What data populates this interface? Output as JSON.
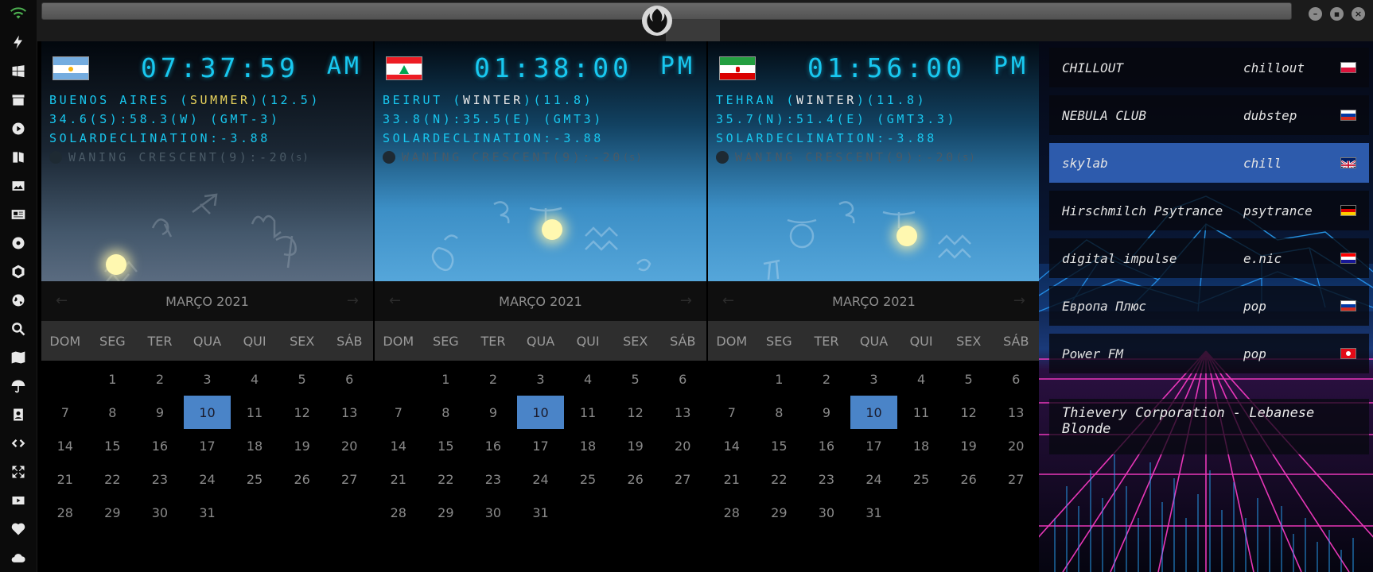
{
  "sidebar": {
    "icons": [
      "wifi-icon",
      "lightning-icon",
      "windows-icon",
      "archive-icon",
      "play-circle-icon",
      "map-book-icon",
      "image-icon",
      "news-icon",
      "rebel-icon",
      "hexagon-icon",
      "globe-icon",
      "search-icon",
      "map-icon",
      "umbrella-icon",
      "contacts-icon",
      "code-icon",
      "expand-icon",
      "youtube-icon",
      "heart-icon",
      "cloud-icon"
    ]
  },
  "cities": [
    {
      "flag": "argentina",
      "time": "07:37:59",
      "ampm": "AM",
      "name": "BUENOS AIRES (",
      "season": "SUMMER",
      "season_tail": ")(12.5)",
      "coords": "34.6(S):58.3(W) (GMT-3)",
      "solar": "SOLARDECLINATION:-3.88",
      "moon": "WANING CRESCENT(9):-20",
      "moon_unit": "(s)",
      "sky": "night"
    },
    {
      "flag": "lebanon",
      "time": "01:38:00",
      "ampm": "PM",
      "name": "BEIRUT (",
      "season": "WINTER",
      "season_tail": ")(11.8)",
      "coords": "33.8(N):35.5(E) (GMT3)",
      "solar": "SOLARDECLINATION:-3.88",
      "moon": "WANING CRESCENT(9):-20",
      "moon_unit": "(s)",
      "sky": "day"
    },
    {
      "flag": "iran",
      "time": "01:56:00",
      "ampm": "PM",
      "name": "TEHRAN (",
      "season": "WINTER",
      "season_tail": ")(11.8)",
      "coords": "35.7(N):51.4(E) (GMT3.3)",
      "solar": "SOLARDECLINATION:-3.88",
      "moon": "WANING CRESCENT(9):-20",
      "moon_unit": "(s)",
      "sky": "day"
    }
  ],
  "calendar": {
    "month": "MARÇO 2021",
    "prev": "←",
    "next": "→",
    "weekdays": [
      "DOM",
      "SEG",
      "TER",
      "QUA",
      "QUI",
      "SEX",
      "SÁB"
    ],
    "leading_blanks": 1,
    "days": 31,
    "today": 10
  },
  "radio": {
    "stations": [
      {
        "name": "CHILLOUT",
        "genre": "chillout",
        "flag": "poland",
        "selected": false
      },
      {
        "name": "NEBULA CLUB",
        "genre": "dubstep",
        "flag": "russia",
        "selected": false
      },
      {
        "name": "skylab",
        "genre": "chill",
        "flag": "uk",
        "selected": true
      },
      {
        "name": "Hirschmilch Psytrance",
        "genre": "psytrance",
        "flag": "germany",
        "selected": false
      },
      {
        "name": "digital impulse",
        "genre": "e.nic",
        "flag": "croatia",
        "selected": false
      },
      {
        "name": "Европа Плюс",
        "genre": "pop",
        "flag": "russia",
        "selected": false
      },
      {
        "name": "Power FM",
        "genre": "pop",
        "flag": "turkey",
        "selected": false
      }
    ],
    "now_playing": "Thievery Corporation - Lebanese Blonde"
  },
  "colors": {
    "clock": "#18c8f0",
    "summer": "#e8d35c",
    "today": "#4a84c8",
    "selected_station": "#3468c4"
  }
}
